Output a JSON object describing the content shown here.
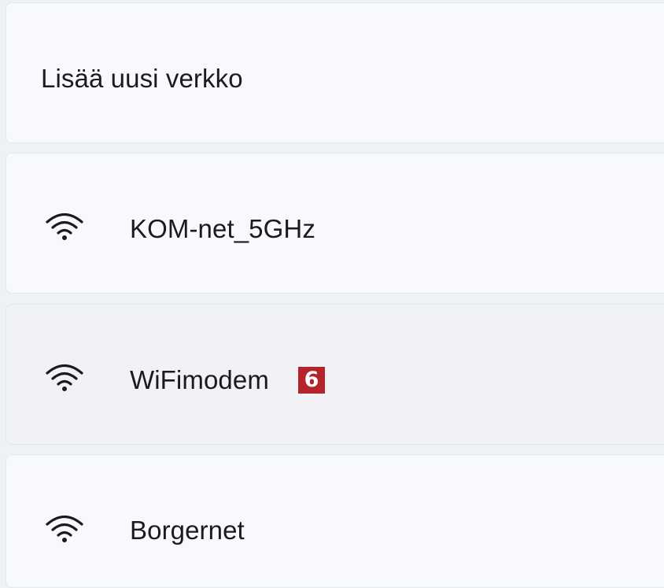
{
  "add_network": {
    "label": "Lisää uusi verkko"
  },
  "networks": [
    {
      "ssid": "KOM-net_5GHz",
      "icon": "wifi-icon"
    },
    {
      "ssid": "WiFimodem",
      "icon": "wifi-icon",
      "badge": "6"
    },
    {
      "ssid": "Borgernet",
      "icon": "wifi-icon"
    }
  ],
  "colors": {
    "badge_bg": "#b5242b",
    "row_bg": "#f8f9fc",
    "row_hover_bg": "#f0f2f6"
  }
}
